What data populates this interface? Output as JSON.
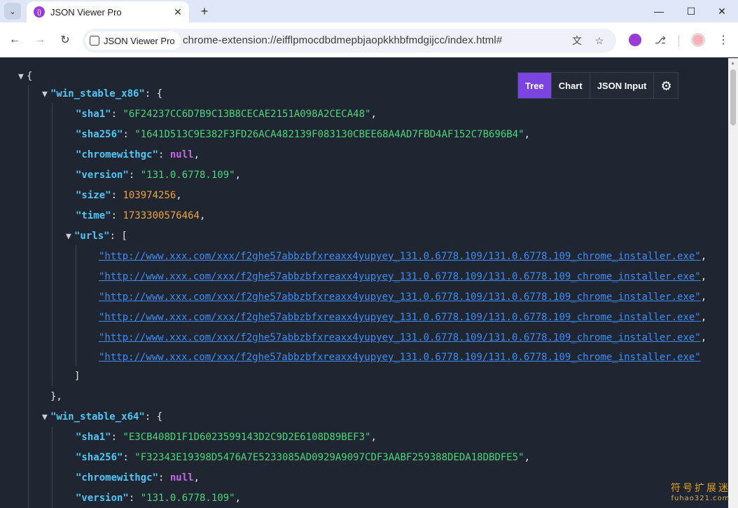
{
  "browser": {
    "tab_title": "JSON Viewer Pro",
    "site_chip": "JSON Viewer Pro",
    "url": "chrome-extension://eifflpmocdbdmepbjaopkkhbfmdgijcc/index.html#"
  },
  "viewer": {
    "tabs": [
      "Tree",
      "Chart",
      "JSON Input"
    ],
    "active_tab": "Tree"
  },
  "json": {
    "root_open": "{",
    "x86": {
      "key": "\"win_stable_x86\"",
      "sha1": "\"6F24237CC6D7B9C13B8CECAE2151A098A2CECA48\"",
      "sha256": "\"1641D513C9E382F3FD26ACA482139F083130CBEE68A4AD7FBD4AF152C7B696B4\"",
      "chromewithgc": "null",
      "version": "\"131.0.6778.109\"",
      "size": "103974256",
      "time": "1733300576464",
      "urls": [
        "\"http://www.xxx.com/xxx/f2ghe57abbzbfxreaxx4yupyey_131.0.6778.109/131.0.6778.109_chrome_installer.exe\"",
        "\"http://www.xxx.com/xxx/f2ghe57abbzbfxreaxx4yupyey_131.0.6778.109/131.0.6778.109_chrome_installer.exe\"",
        "\"http://www.xxx.com/xxx/f2ghe57abbzbfxreaxx4yupyey_131.0.6778.109/131.0.6778.109_chrome_installer.exe\"",
        "\"http://www.xxx.com/xxx/f2ghe57abbzbfxreaxx4yupyey_131.0.6778.109/131.0.6778.109_chrome_installer.exe\"",
        "\"http://www.xxx.com/xxx/f2ghe57abbzbfxreaxx4yupyey_131.0.6778.109/131.0.6778.109_chrome_installer.exe\"",
        "\"http://www.xxx.com/xxx/f2ghe57abbzbfxreaxx4yupyey_131.0.6778.109/131.0.6778.109_chrome_installer.exe\""
      ]
    },
    "x64": {
      "key": "\"win_stable_x64\"",
      "sha1": "\"E3CB408D1F1D6023599143D2C9D2E6108D89BEF3\"",
      "sha256": "\"F32343E19398D5476A7E5233085AD0929A9097CDF3AABF259388DEDA18DBDFE5\"",
      "chromewithgc": "null",
      "version": "\"131.0.6778.109\""
    },
    "keys": {
      "sha1": "\"sha1\"",
      "sha256": "\"sha256\"",
      "chromewithgc": "\"chromewithgc\"",
      "version": "\"version\"",
      "size": "\"size\"",
      "time": "\"time\"",
      "urls": "\"urls\""
    }
  },
  "watermark": {
    "line1": "符号扩展迷",
    "line2": "fuhao321.com"
  },
  "colors": {
    "background": "#1f2631",
    "key": "#52c7f5",
    "string": "#4ad57b",
    "number": "#f0a33a",
    "null": "#c36be3",
    "link": "#3f8cf5",
    "active_tab": "#7b44e0"
  }
}
